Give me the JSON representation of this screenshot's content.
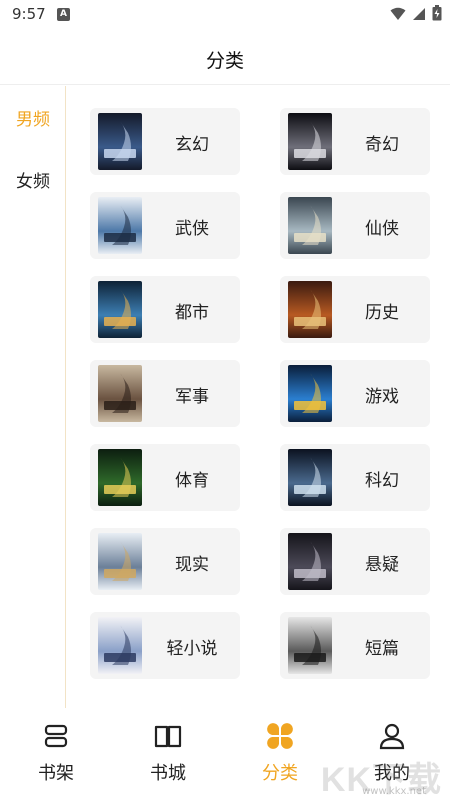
{
  "status_bar": {
    "time": "9:57",
    "badge": "A"
  },
  "header": {
    "title": "分类"
  },
  "side_nav": {
    "items": [
      {
        "label": "男频",
        "active": true
      },
      {
        "label": "女频",
        "active": false
      }
    ]
  },
  "categories": [
    {
      "label": "玄幻",
      "cover_colors": [
        "#141a2a",
        "#3a5a8a",
        "#c8d8f0"
      ]
    },
    {
      "label": "奇幻",
      "cover_colors": [
        "#0d0d12",
        "#6f6f7a",
        "#dcdce2"
      ]
    },
    {
      "label": "武侠",
      "cover_colors": [
        "#e9eef4",
        "#4d78a8",
        "#1b2b44"
      ]
    },
    {
      "label": "仙侠",
      "cover_colors": [
        "#3a4650",
        "#a8b9c2",
        "#e7e0c8"
      ]
    },
    {
      "label": "都市",
      "cover_colors": [
        "#0e2236",
        "#3d7fb3",
        "#e8b050"
      ]
    },
    {
      "label": "历史",
      "cover_colors": [
        "#3a1a10",
        "#b85a22",
        "#e9c27a"
      ]
    },
    {
      "label": "军事",
      "cover_colors": [
        "#c8b8a0",
        "#6a5240",
        "#2a1e18"
      ]
    },
    {
      "label": "游戏",
      "cover_colors": [
        "#0a1e3a",
        "#2b7fd0",
        "#f2c23a"
      ]
    },
    {
      "label": "体育",
      "cover_colors": [
        "#0c1e10",
        "#2f6a2a",
        "#e5cc58"
      ]
    },
    {
      "label": "科幻",
      "cover_colors": [
        "#0b1220",
        "#4a6a8e",
        "#cfe0ef"
      ]
    },
    {
      "label": "现实",
      "cover_colors": [
        "#e8eef4",
        "#6b7f98",
        "#d0a860"
      ]
    },
    {
      "label": "悬疑",
      "cover_colors": [
        "#15141a",
        "#4c4a58",
        "#bfbcc8"
      ]
    },
    {
      "label": "轻小说",
      "cover_colors": [
        "#f2f2f6",
        "#8aa0c8",
        "#2c3a60"
      ]
    },
    {
      "label": "短篇",
      "cover_colors": [
        "#e6e6e6",
        "#5a5a5a",
        "#1a1a1a"
      ]
    }
  ],
  "tab_bar": {
    "tabs": [
      {
        "label": "书架",
        "icon": "bookshelf-icon",
        "active": false
      },
      {
        "label": "书城",
        "icon": "open-book-icon",
        "active": false
      },
      {
        "label": "分类",
        "icon": "category-grid-icon",
        "active": true
      },
      {
        "label": "我的",
        "icon": "user-icon",
        "active": false
      }
    ]
  },
  "watermark": {
    "text": "KK下载",
    "url": "www.kkx.net"
  },
  "colors": {
    "accent": "#f0a522",
    "card_bg": "#f4f4f4",
    "text": "#222222"
  }
}
